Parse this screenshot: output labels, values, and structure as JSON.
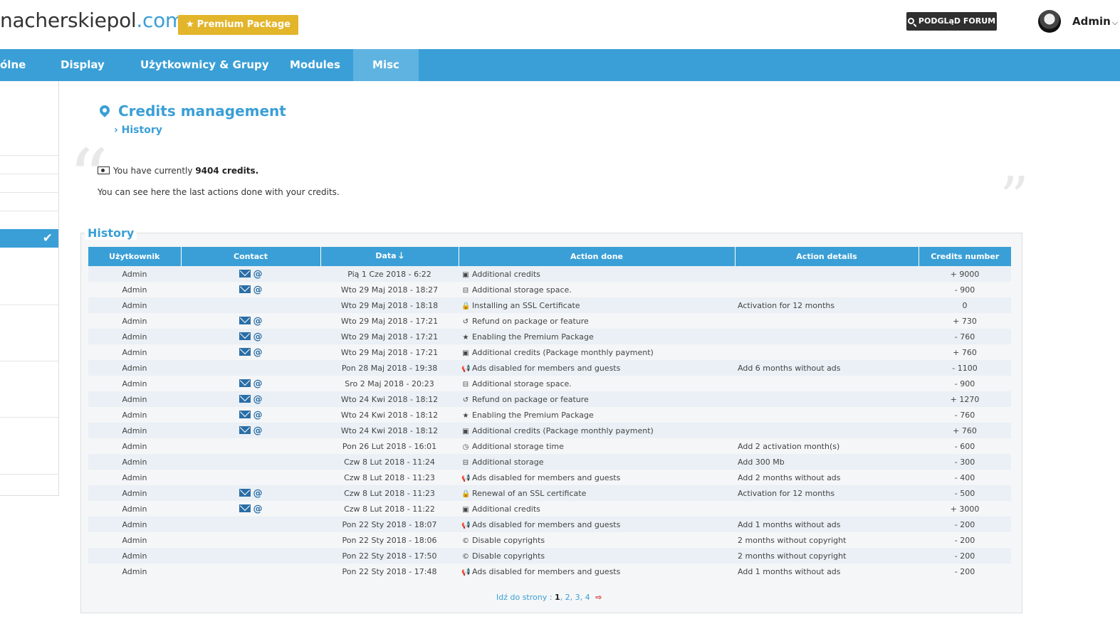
{
  "header": {
    "site_name": "nacherskiepol",
    "site_tld": ".com",
    "premium_label": "Premium Package",
    "forum_button": "PODGLąD FORUM",
    "user_name": "Admin"
  },
  "nav": {
    "items": [
      "ólne",
      "Display",
      "Użytkownicy & Grupy",
      "Modules",
      "Misc"
    ],
    "active": "Misc"
  },
  "page": {
    "title": "Credits management",
    "breadcrumb": "History",
    "info_prefix": "You have currently",
    "credits_total": "9404 credits.",
    "info_line2": "You can see here the last actions done with your credits."
  },
  "history": {
    "legend": "History",
    "columns": [
      "Użytkownik",
      "Contact",
      "Data",
      "Action done",
      "Action details",
      "Credits number"
    ],
    "rows": [
      {
        "user": "Admin",
        "contact": true,
        "date": "Pią 1 Cze 2018 - 6:22",
        "icon": "money-icon",
        "action": "Additional credits",
        "details": "",
        "credits": "+ 9000",
        "sign": "pos"
      },
      {
        "user": "Admin",
        "contact": true,
        "date": "Wto 29 Maj 2018 - 18:27",
        "icon": "storage-icon",
        "action": "Additional storage space.",
        "details": "",
        "credits": "- 900",
        "sign": "neg"
      },
      {
        "user": "Admin",
        "contact": false,
        "date": "Wto 29 Maj 2018 - 18:18",
        "icon": "lock-icon",
        "action": "Installing an SSL Certificate",
        "details": "Activation for 12 months",
        "credits": "0",
        "sign": "zero"
      },
      {
        "user": "Admin",
        "contact": true,
        "date": "Wto 29 Maj 2018 - 17:21",
        "icon": "refund-icon",
        "action": "Refund on package or feature",
        "details": "",
        "credits": "+ 730",
        "sign": "pos"
      },
      {
        "user": "Admin",
        "contact": true,
        "date": "Wto 29 Maj 2018 - 17:21",
        "icon": "star-icon",
        "action": "Enabling the Premium Package",
        "details": "",
        "credits": "- 760",
        "sign": "neg"
      },
      {
        "user": "Admin",
        "contact": true,
        "date": "Wto 29 Maj 2018 - 17:21",
        "icon": "money-icon",
        "action": "Additional credits (Package monthly payment)",
        "details": "",
        "credits": "+ 760",
        "sign": "pos"
      },
      {
        "user": "Admin",
        "contact": false,
        "date": "Pon 28 Maj 2018 - 19:38",
        "icon": "megaphone-icon",
        "action": "Ads disabled for members and guests",
        "details": "Add 6 months without ads",
        "credits": "- 1100",
        "sign": "neg"
      },
      {
        "user": "Admin",
        "contact": true,
        "date": "Sro 2 Maj 2018 - 20:23",
        "icon": "storage-icon",
        "action": "Additional storage space.",
        "details": "",
        "credits": "- 900",
        "sign": "neg"
      },
      {
        "user": "Admin",
        "contact": true,
        "date": "Wto 24 Kwi 2018 - 18:12",
        "icon": "refund-icon",
        "action": "Refund on package or feature",
        "details": "",
        "credits": "+ 1270",
        "sign": "pos"
      },
      {
        "user": "Admin",
        "contact": true,
        "date": "Wto 24 Kwi 2018 - 18:12",
        "icon": "star-icon",
        "action": "Enabling the Premium Package",
        "details": "",
        "credits": "- 760",
        "sign": "neg"
      },
      {
        "user": "Admin",
        "contact": true,
        "date": "Wto 24 Kwi 2018 - 18:12",
        "icon": "money-icon",
        "action": "Additional credits (Package monthly payment)",
        "details": "",
        "credits": "+ 760",
        "sign": "pos"
      },
      {
        "user": "Admin",
        "contact": false,
        "date": "Pon 26 Lut 2018 - 16:01",
        "icon": "clock-icon",
        "action": "Additional storage time",
        "details": "Add 2 activation month(s)",
        "credits": "- 600",
        "sign": "neg"
      },
      {
        "user": "Admin",
        "contact": false,
        "date": "Czw 8 Lut 2018 - 11:24",
        "icon": "storage-icon",
        "action": "Additional storage",
        "details": "Add 300 Mb",
        "credits": "- 300",
        "sign": "neg"
      },
      {
        "user": "Admin",
        "contact": false,
        "date": "Czw 8 Lut 2018 - 11:23",
        "icon": "megaphone-icon",
        "action": "Ads disabled for members and guests",
        "details": "Add 2 months without ads",
        "credits": "- 400",
        "sign": "neg"
      },
      {
        "user": "Admin",
        "contact": true,
        "date": "Czw 8 Lut 2018 - 11:23",
        "icon": "lock-icon",
        "action": "Renewal of an SSL certificate",
        "details": "Activation for 12 months",
        "credits": "- 500",
        "sign": "neg"
      },
      {
        "user": "Admin",
        "contact": true,
        "date": "Czw 8 Lut 2018 - 11:22",
        "icon": "money-icon",
        "action": "Additional credits",
        "details": "",
        "credits": "+ 3000",
        "sign": "pos"
      },
      {
        "user": "Admin",
        "contact": false,
        "date": "Pon 22 Sty 2018 - 18:07",
        "icon": "megaphone-icon",
        "action": "Ads disabled for members and guests",
        "details": "Add 1 months without ads",
        "credits": "- 200",
        "sign": "neg"
      },
      {
        "user": "Admin",
        "contact": false,
        "date": "Pon 22 Sty 2018 - 18:06",
        "icon": "copyright-icon",
        "action": "Disable copyrights",
        "details": "2 months without copyright",
        "credits": "- 200",
        "sign": "neg"
      },
      {
        "user": "Admin",
        "contact": false,
        "date": "Pon 22 Sty 2018 - 17:50",
        "icon": "copyright-icon",
        "action": "Disable copyrights",
        "details": "2 months without copyright",
        "credits": "- 200",
        "sign": "neg"
      },
      {
        "user": "Admin",
        "contact": false,
        "date": "Pon 22 Sty 2018 - 17:48",
        "icon": "megaphone-icon",
        "action": "Ads disabled for members and guests",
        "details": "Add 1 months without ads",
        "credits": "- 200",
        "sign": "neg"
      }
    ]
  },
  "pagination": {
    "label": "Idź do strony :",
    "pages": [
      "1",
      "2",
      "3",
      "4"
    ],
    "current": "1"
  }
}
